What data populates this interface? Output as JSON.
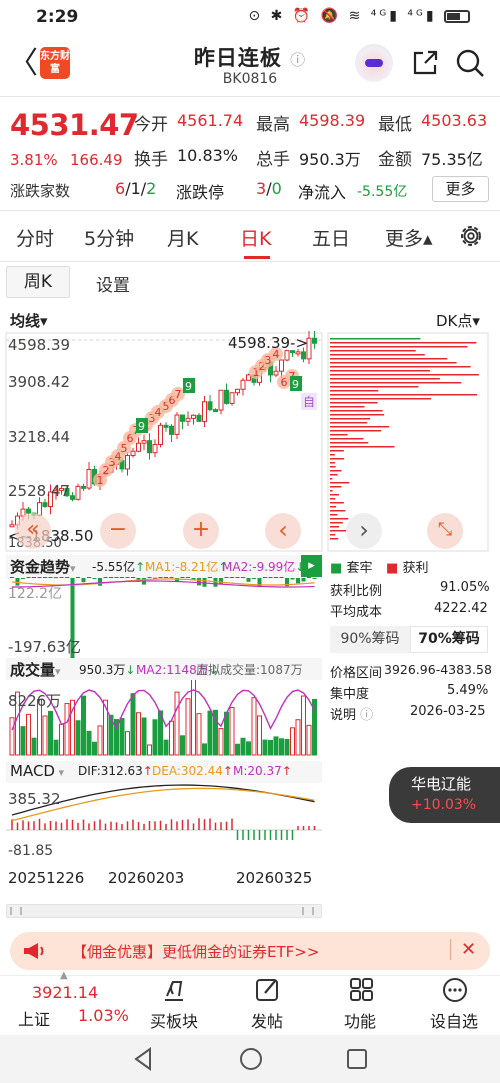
{
  "status_bar": {
    "time": "2:29",
    "icons": "⊙ ✱ ⏰ 🔕 ≋ ⁴ᴳ▮ ⁴ᴳ▮"
  },
  "header": {
    "back": "〈",
    "brand": "东方财富",
    "title": "昨日连板",
    "info_icon": "ⓘ",
    "code": "BK0816"
  },
  "quote": {
    "price": "4531.47",
    "change_pct": "3.81%",
    "change_amt": "166.49",
    "open_label": "今开",
    "open": "4561.74",
    "high_label": "最高",
    "high": "4598.39",
    "low_label": "最低",
    "low": "4503.63",
    "turnover_label": "换手",
    "turnover": "10.83%",
    "volume_label": "总手",
    "volume": "950.3万",
    "amount_label": "金额",
    "amount": "75.35亿",
    "updown_label": "涨跌家数",
    "updown_up": "6",
    "updown_sep1": "/",
    "updown_flat": "1",
    "updown_sep2": "/",
    "updown_down": "2",
    "limit_label": "涨跌停",
    "limit_up": "3",
    "limit_sep": "/",
    "limit_down": "0",
    "inflow_label": "净流入",
    "inflow": "-5.55亿",
    "more_label": "更多"
  },
  "period_tabs": [
    "分时",
    "5分钟",
    "月K",
    "日K",
    "五日",
    "更多▴"
  ],
  "sub_tabs": {
    "week": "周K",
    "settings": "设置"
  },
  "chart": {
    "ma_label": "均线▾",
    "dk_label": "DK点▾",
    "y_ticks": [
      "4598.39",
      "3908.42",
      "3218.44",
      "2528.47",
      "1838.50"
    ],
    "high_marker": "4598.39->",
    "low_marker": "<--1838.50",
    "zoom_out": "−",
    "zoom_in": "+",
    "prev": "‹",
    "next": "›",
    "expand": "⤡",
    "self_label": "自"
  },
  "fund_flow": {
    "title": "资金趋势",
    "value": "-5.55亿",
    "ma1": "MA1:-8.21亿",
    "ma2": "MA2:-9.99亿",
    "y_top": "122.2亿",
    "y_bottom": "-197.63亿"
  },
  "volume_panel": {
    "title": "成交量",
    "value": "950.3万",
    "ma2": "MA2:1148万",
    "virtual": "虚拟成交量:1087万",
    "y_top": "8226万"
  },
  "macd_panel": {
    "title": "MACD",
    "dif": "DIF:312.63",
    "dea": "DEA:302.44",
    "m": "M:20.37",
    "y_top": "385.32",
    "y_bottom": "-81.85"
  },
  "x_dates": [
    "20251226",
    "20260203",
    "20260325"
  ],
  "chip_panel": {
    "legend_trap": "套牢",
    "legend_profit": "获利",
    "profit_ratio_label": "获利比例",
    "profit_ratio": "91.05%",
    "avg_cost_label": "平均成本",
    "avg_cost": "4222.42",
    "tab90": "90%筹码",
    "tab70": "70%筹码",
    "range_label": "价格区间",
    "range": "3926.96-4383.58",
    "concentration_label": "集中度",
    "concentration": "5.49%",
    "note_label": "说明",
    "note_date": "2026-03-25"
  },
  "floating_card": {
    "name": "华电辽能",
    "change": "+10.03%"
  },
  "ad_banner": {
    "text": "【佣金优惠】更低佣金的证券ETF>>",
    "close": "✕"
  },
  "bottom_nav": {
    "index_value": "3921.14",
    "index_name": "上证",
    "index_change": "1.03%",
    "items": [
      "买板块",
      "发帖",
      "功能",
      "设自选"
    ]
  },
  "colors": {
    "up": "#e0282e",
    "down": "#1b9e3f",
    "accent_orange": "#e89a1a",
    "magenta": "#c030c0"
  }
}
